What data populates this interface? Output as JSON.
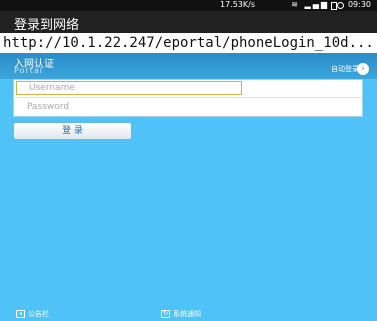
{
  "status_bar": {
    "network_speed": "17.53K/s",
    "icons": "≋ ▂▄▆",
    "time": "09:30"
  },
  "app": {
    "title": "登录到网络"
  },
  "browser": {
    "url": "http://10.1.22.247/eportal/phoneLogin_10d..."
  },
  "header": {
    "title_cn": "入网认证",
    "title_en": "Portal",
    "auto_login_label": "自动登录",
    "auto_login_icon": "chevron-right-circle-icon"
  },
  "form": {
    "username_placeholder": "Username",
    "password_placeholder": "Password",
    "username_value": "",
    "password_value": ""
  },
  "login_button": {
    "label": "登 录"
  },
  "footer": {
    "announcement_label": "公告栏",
    "notice_label": "系统通知"
  },
  "colors": {
    "background": "#4fc3f7",
    "header_band": "#2c8bc7",
    "title_bar": "#212121",
    "username_focus_border": "#d8b042"
  }
}
